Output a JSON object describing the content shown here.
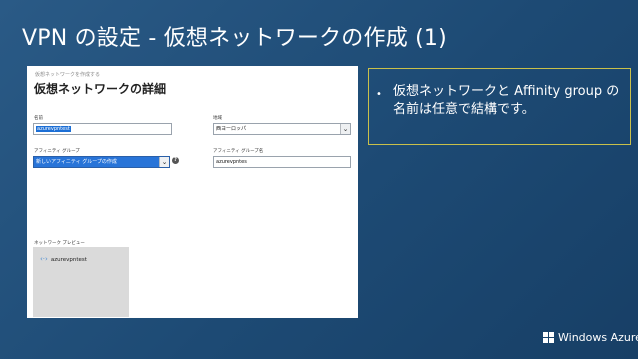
{
  "slide": {
    "title": "VPN の設定 - 仮想ネットワークの作成 (1)",
    "callout": {
      "bullet": "•",
      "text": "仮想ネットワークと Affinity group の名前は任意で結構です。"
    },
    "logo": {
      "text": "Windows Azure",
      "icon": "windows-logo-icon"
    }
  },
  "screenshot": {
    "breadcrumb": "仮想ネットワークを作成する",
    "section_title": "仮想ネットワークの詳細",
    "name": {
      "label": "名前",
      "value": "azurevpntest"
    },
    "region": {
      "label": "地域",
      "value": "西ヨーロッパ"
    },
    "affinity_group": {
      "label": "アフィニティ グループ",
      "value": "新しいアフィニティ グループの作成"
    },
    "affinity_group_name": {
      "label": "アフィニティ グループ名",
      "value": "azurevpntes"
    },
    "help_icon": "?",
    "preview": {
      "label": "ネットワーク プレビュー",
      "node_icon": "network-icon",
      "node_label": "azurevpntest"
    }
  }
}
